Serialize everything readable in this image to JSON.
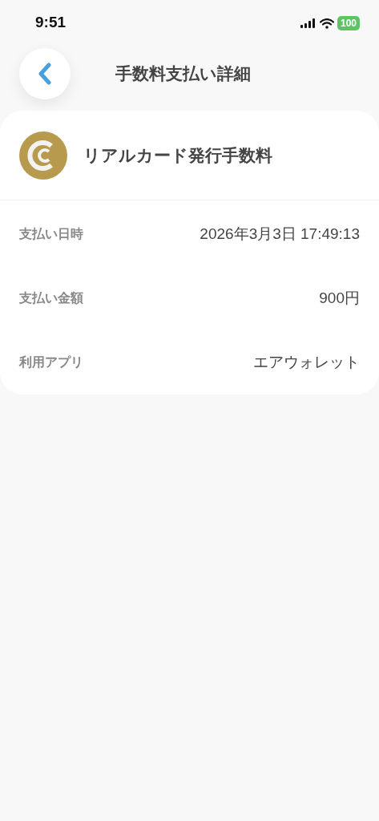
{
  "status_bar": {
    "time": "9:51",
    "battery": "100"
  },
  "header": {
    "title": "手数料支払い詳細"
  },
  "detail": {
    "title": "リアルカード発行手数料",
    "rows": [
      {
        "label": "支払い日時",
        "value": "2026年3月3日 17:49:13"
      },
      {
        "label": "支払い金額",
        "value": "900円"
      },
      {
        "label": "利用アプリ",
        "value": "エアウォレット"
      }
    ]
  }
}
